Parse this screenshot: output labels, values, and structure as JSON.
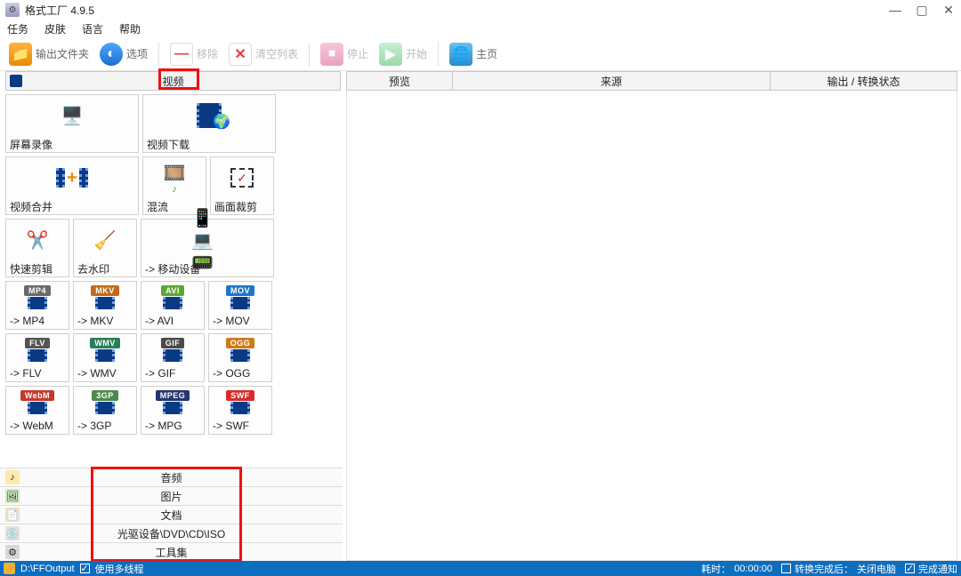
{
  "title": "格式工厂 4.9.5",
  "menu": {
    "task": "任务",
    "skin": "皮肤",
    "lang": "语言",
    "help": "帮助"
  },
  "toolbar": {
    "output": "输出文件夹",
    "options": "选项",
    "remove": "移除",
    "clear": "清空列表",
    "stop": "停止",
    "start": "开始",
    "home": "主页"
  },
  "leftTab": "视频",
  "tiles": {
    "screenrec": "屏幕录像",
    "viddl": "视频下载",
    "merge": "视频合并",
    "mix": "混流",
    "crop": "画面裁剪",
    "quick": "快速剪辑",
    "rmwm": "去水印",
    "mobile": "-> 移动设备",
    "mp4": "-> MP4",
    "mkv": "-> MKV",
    "avi": "-> AVI",
    "mov": "-> MOV",
    "flv": "-> FLV",
    "wmv": "-> WMV",
    "gif": "-> GIF",
    "ogg": "-> OGG",
    "webm": "-> WebM",
    "3gp": "-> 3GP",
    "mpg": "-> MPG",
    "swf": "-> SWF"
  },
  "fmtTags": {
    "mp4": "MP4",
    "mkv": "MKV",
    "avi": "AVI",
    "mov": "MOV",
    "flv": "FLV",
    "wmv": "WMV",
    "gif": "GIF",
    "ogg": "OGG",
    "webm": "WebM",
    "3gp": "3GP",
    "mpg": "MPEG",
    "swf": "SWF"
  },
  "fmtColors": {
    "mp4": "#6a6a6a",
    "mkv": "#c26a1a",
    "avi": "#5aa82e",
    "mov": "#1f77c9",
    "flv": "#555",
    "wmv": "#2a7d5a",
    "gif": "#4a4a4a",
    "ogg": "#d07a1a",
    "webm": "#c23a2a",
    "3gp": "#4a8a4a",
    "mpg": "#25356f",
    "swf": "#d92b2b"
  },
  "cats": {
    "audio": "音频",
    "image": "图片",
    "doc": "文档",
    "rom": "光驱设备\\DVD\\CD\\ISO",
    "tools": "工具集"
  },
  "rightHeaders": {
    "preview": "预览",
    "source": "来源",
    "status": "输出 / 转换状态"
  },
  "status": {
    "path": "D:\\FFOutput",
    "multi": "使用多线程",
    "elapsed_lbl": "耗时：",
    "elapsed_v": "00:00:00",
    "after_lbl": "转换完成后：",
    "after_v": "关闭电脑",
    "notify": "完成通知"
  }
}
